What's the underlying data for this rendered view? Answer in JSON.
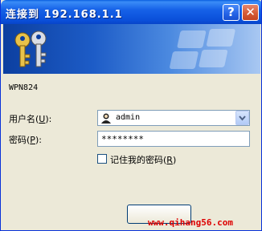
{
  "window": {
    "title": "连接到 192.168.1.1"
  },
  "titlebar": {
    "help_label": "?",
    "close_label": "✕"
  },
  "device_name": "WPN824",
  "form": {
    "username_label": "用户名",
    "username_hotkey": "U",
    "username_value": "admin",
    "password_label": "密码",
    "password_hotkey": "P",
    "password_value": "********",
    "remember_label": "记住我的密码",
    "remember_hotkey": "R",
    "remember_checked": false
  },
  "icons": [
    "keys-icon",
    "user-icon",
    "chevron-down-icon",
    "help-icon",
    "close-icon"
  ],
  "watermark": "www.qihang56.com"
}
